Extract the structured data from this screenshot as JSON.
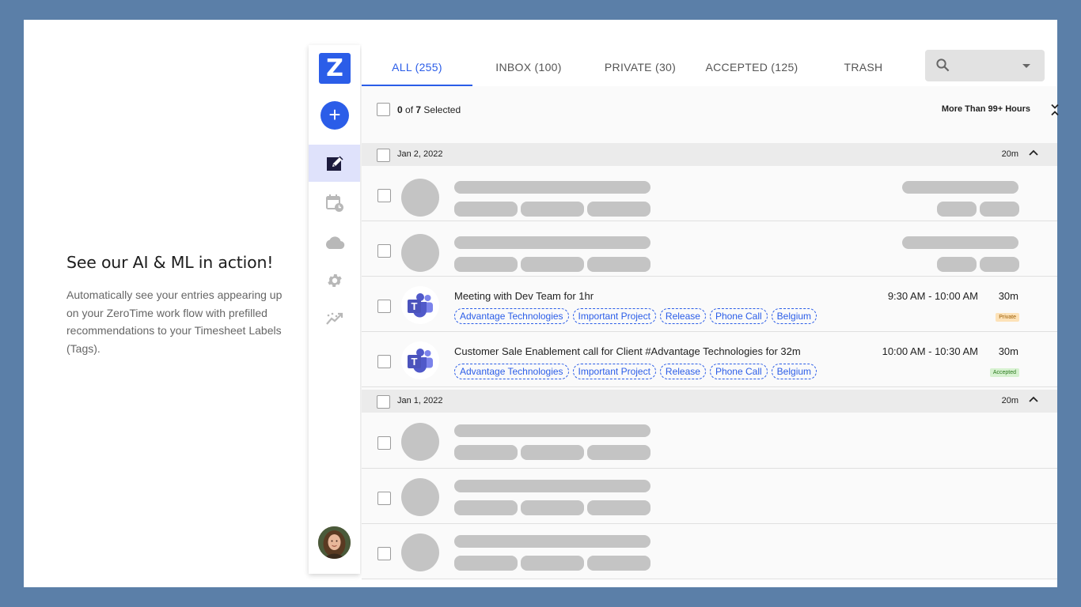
{
  "promo": {
    "title": "See our AI & ML in action!",
    "description": "Automatically see your entries appearing up on your ZeroTime work flow with prefilled recommendations to your Timesheet Labels (Tags)."
  },
  "sidebar": {
    "logo_text": "Z",
    "add_label": "+",
    "items": [
      {
        "icon": "edit-note-icon",
        "active": true
      },
      {
        "icon": "calendar-clock-icon",
        "active": false
      },
      {
        "icon": "cloud-icon",
        "active": false
      },
      {
        "icon": "gear-icon",
        "active": false
      },
      {
        "icon": "trending-chart-icon",
        "active": false
      }
    ]
  },
  "tabs": [
    {
      "label": "ALL (255)",
      "active": true
    },
    {
      "label": "INBOX (100)",
      "active": false
    },
    {
      "label": "PRIVATE (30)",
      "active": false
    },
    {
      "label": "ACCEPTED (125)",
      "active": false
    },
    {
      "label": "TRASH",
      "active": false
    }
  ],
  "selection": {
    "selected": "0",
    "of_label": "of",
    "total": "7",
    "suffix": "Selected",
    "hours_label": "More Than 99+ Hours"
  },
  "groups": [
    {
      "date": "Jan 2, 2022",
      "duration": "20m"
    },
    {
      "date": "Jan 1, 2022",
      "duration": "20m"
    }
  ],
  "events": [
    {
      "title": "Meeting with Dev Team for 1hr",
      "tags": [
        "Advantage Technologies",
        "Important Project",
        "Release",
        "Phone Call",
        "Belgium"
      ],
      "time": "9:30 AM - 10:00 AM",
      "duration": "30m",
      "status": "Private"
    },
    {
      "title": "Customer Sale Enablement call for Client #Advantage Technologies for 32m",
      "tags": [
        "Advantage Technologies",
        "Important Project",
        "Release",
        "Phone Call",
        "Belgium"
      ],
      "time": "10:00 AM - 10:30 AM",
      "duration": "30m",
      "status": "Accepted"
    }
  ],
  "colors": {
    "accent": "#2b5de8",
    "background": "#5b7fa8",
    "private_badge": "#fde2b8",
    "accepted_badge": "#d6f1d0",
    "placeholder": "#c4c4c4"
  }
}
